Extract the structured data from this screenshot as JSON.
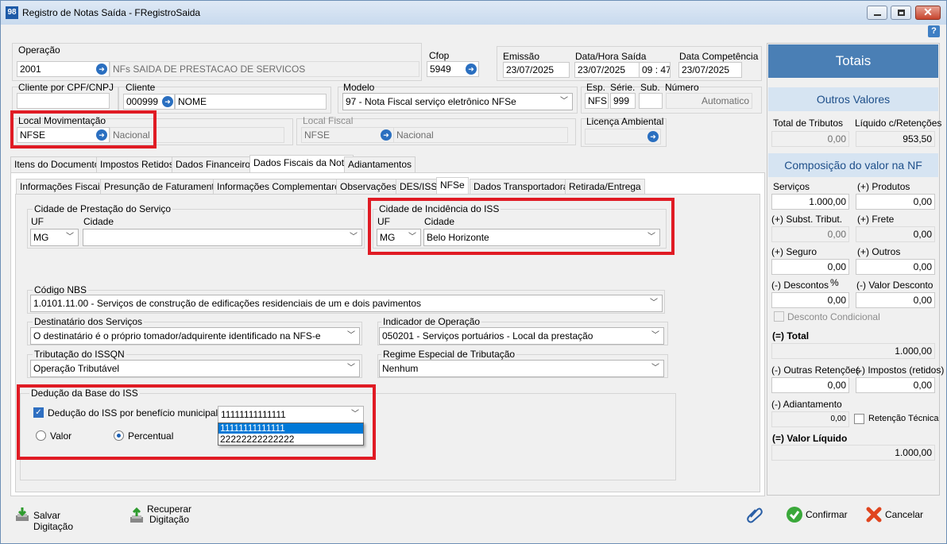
{
  "window": {
    "title": "Registro de Notas Saída - FRegistroSaida",
    "app_icon": "98"
  },
  "header": {
    "operacao_label": "Operação",
    "operacao_code": "2001",
    "operacao_desc": "NFs SAIDA DE PRESTACAO DE SERVICOS",
    "cfop_label": "Cfop",
    "cfop_value": "5949",
    "emissao_label": "Emissão",
    "emissao_value": "23/07/2025",
    "data_hora_saida_label": "Data/Hora Saída",
    "data_saida_value": "23/07/2025",
    "hora_h": "09",
    "hora_m": "47",
    "data_competencia_label": "Data Competência",
    "data_competencia_value": "23/07/2025",
    "cliente_cpf_label": "Cliente por CPF/CNPJ",
    "cliente_cpf_value": "",
    "cliente_label": "Cliente",
    "cliente_code": "000999",
    "cliente_nome": "NOME",
    "modelo_label": "Modelo",
    "modelo_value": "97 - Nota Fiscal serviço eletrônico NFSe",
    "esp_label": "Esp.",
    "esp_value": "NFS",
    "serie_label": "Série.",
    "serie_value": "999",
    "sub_label": "Sub.",
    "sub_value": "",
    "numero_label": "Número",
    "numero_value": "Automatico",
    "local_mov_label": "Local Movimentação",
    "local_mov_value": "NFSE",
    "local_mov_desc": "Nacional",
    "local_fiscal_label": "Local Fiscal",
    "local_fiscal_value": "NFSE",
    "local_fiscal_desc": "Nacional",
    "licenca_label": "Licença Ambiental",
    "licenca_value": ""
  },
  "main_tabs": [
    "Itens do Documento",
    "Impostos Retidos",
    "Dados Financeiros",
    "Dados Fiscais da Nota",
    "Adiantamentos"
  ],
  "sub_tabs": [
    "Informações Fiscais",
    "Presunção de Faturamento",
    "Informações Complementares",
    "Observações",
    "DES/ISS",
    "NFSe",
    "Dados Transportadora",
    "Retirada/Entrega"
  ],
  "nfse": {
    "prestacao_title": "Cidade de Prestação do Serviço",
    "uf_label": "UF",
    "cidade_label": "Cidade",
    "prestacao_uf": "MG",
    "prestacao_cidade": "",
    "incidencia_title": "Cidade de Incidência do ISS",
    "incidencia_uf": "MG",
    "incidencia_cidade": "Belo Horizonte",
    "nbs_label": "Código NBS",
    "nbs_value": "1.0101.11.00 - Serviços de construção de edificações residenciais de um e dois pavimentos",
    "destinatario_label": "Destinatário dos Serviços",
    "destinatario_value": "O destinatário é o próprio tomador/adquirente identificado na NFS-e",
    "indicador_label": "Indicador de Operação",
    "indicador_value": "050201 - Serviços portuários - Local da prestação",
    "tributacao_label": "Tributação do ISSQN",
    "tributacao_value": "Operação Tributável",
    "regime_label": "Regime Especial de Tributação",
    "regime_value": "Nenhum",
    "deducao_title": "Dedução da Base do ISS",
    "deducao_check_label": "Dedução do ISS por benefício municipal",
    "valor_label": "Valor",
    "percentual_label": "Percentual",
    "deducao_selected": "11111111111111",
    "deducao_options": [
      "11111111111111",
      "22222222222222"
    ]
  },
  "totais": {
    "title": "Totais",
    "outros_valores": "Outros Valores",
    "total_tributos_label": "Total de Tributos",
    "total_tributos_value": "0,00",
    "liquido_retencoes_label": "Líquido c/Retenções",
    "liquido_retencoes_value": "953,50",
    "composicao_title": "Composição do valor na NF",
    "servicos_label": "Serviços",
    "servicos_value": "1.000,00",
    "produtos_label": "(+) Produtos",
    "produtos_value": "0,00",
    "subst_label": "(+) Subst. Tribut.",
    "subst_value": "0,00",
    "frete_label": "(+) Frete",
    "frete_value": "0,00",
    "seguro_label": "(+) Seguro",
    "seguro_value": "0,00",
    "outros_label": "(+) Outros",
    "outros_value": "0,00",
    "descontos_label": "(-) Descontos",
    "descontos_pct": "%",
    "descontos_value": "0,00",
    "valor_desconto_label": "(-) Valor Desconto",
    "valor_desconto_value": "0,00",
    "desconto_condicional_label": "Desconto Condicional",
    "total_label": "(=) Total",
    "total_value": "1.000,00",
    "outras_retencoes_label": "(-) Outras Retenções",
    "outras_retencoes_value": "0,00",
    "impostos_retidos_label": "(-) Impostos (retidos)",
    "impostos_retidos_value": "0,00",
    "adiantamento_label": "(-) Adiantamento",
    "adiantamento_value": "0,00",
    "retencao_tecnica_label": "Retenção Técnica",
    "valor_liquido_label": "(=) Valor Líquido",
    "valor_liquido_value": "1.000,00"
  },
  "footer": {
    "salvar_label": "Salvar Digitação",
    "recuperar_label_1": "Recuperar",
    "recuperar_label_2": "Digitação",
    "confirmar_label": "Confirmar",
    "cancelar_label": "Cancelar"
  },
  "colors": {
    "highlight_red": "#e01b24",
    "panel_blue": "#4a7fb5",
    "subhead_blue": "#d6e4f2"
  }
}
